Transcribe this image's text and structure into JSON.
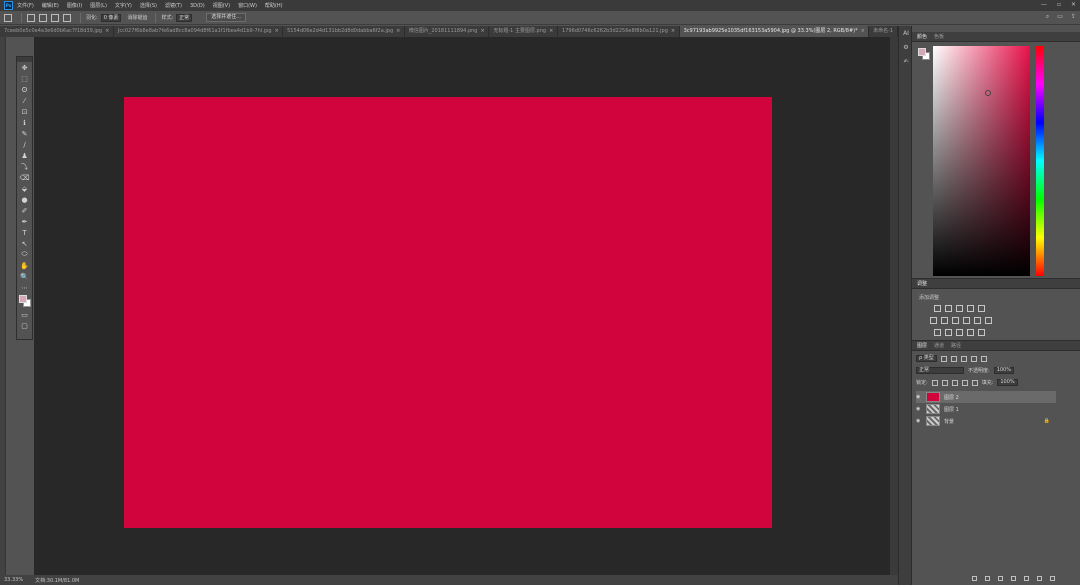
{
  "menubar": {
    "logo": "Ps",
    "items": [
      "文件(F)",
      "编辑(E)",
      "图像(I)",
      "图层(L)",
      "文字(Y)",
      "选择(S)",
      "滤镜(T)",
      "3D(D)",
      "视图(V)",
      "窗口(W)",
      "帮助(H)"
    ],
    "window_controls": [
      "—",
      "▫",
      "✕"
    ]
  },
  "options_bar": {
    "feather_label": "羽化:",
    "feather_value": "0 像素",
    "antialias_label": "消除锯齿",
    "style_label": "样式:",
    "style_value": "正常",
    "select_button": "选择并遮住..."
  },
  "tabs": [
    {
      "label": "7ceeb0e5c0e4a3e6d0b6ac7f18d39.jpg",
      "active": false
    },
    {
      "label": "Jcc027f6b8e8ab7fe6ad8cc8a094d8f61a1f1fbea4d1b9-7hl.jpg",
      "active": false
    },
    {
      "label": "5154d06e2d4d131bb2d8d0dabba6f2a.jpg",
      "active": false
    },
    {
      "label": "微信图片_20181111894.png",
      "active": false
    },
    {
      "label": "无标题-1 主要图层.png",
      "active": false
    },
    {
      "label": "1796d0746c6262b3d2256e8f8b0a121.jpg",
      "active": false
    },
    {
      "label": "3c97193ab9925e1035df163153a5904.jpg @ 33.3%(图层 2, RGB/8#)*",
      "active": true
    },
    {
      "label": "未命名-1",
      "active": false
    }
  ],
  "tools": [
    "✥",
    "⬚",
    "ʘ",
    "⁄",
    "⊡",
    "ℹ",
    "✎",
    "∕",
    "♟",
    "⤵",
    "⌫",
    "⬙",
    "●",
    "✐",
    "✒",
    "T",
    "↖",
    "⬭",
    "✋",
    "🔍",
    "⋯"
  ],
  "status": {
    "zoom": "33.33%",
    "doc_info": "文档:30.1M/81.0M"
  },
  "right_strip_icons": [
    "AI",
    "⚙",
    "✍"
  ],
  "color_panel": {
    "tabs": [
      "颜色",
      "色板"
    ],
    "foreground": "#d5a7b7",
    "background": "#ffffff",
    "hue_color": "#e8124a"
  },
  "adjustments_panel": {
    "tab": "调整",
    "subtitle": "添加调整"
  },
  "layers_panel": {
    "tabs": [
      "图层",
      "通道",
      "路径"
    ],
    "filter_label": "ρ 类型",
    "blend_mode": "正常",
    "opacity_label": "不透明度:",
    "opacity_value": "100%",
    "lock_label": "锁定:",
    "fill_label": "填充:",
    "fill_value": "100%",
    "layers": [
      {
        "name": "图层 2",
        "thumb": "red",
        "selected": true,
        "locked": false
      },
      {
        "name": "图层 1",
        "thumb": "pattern",
        "selected": false,
        "locked": false
      },
      {
        "name": "背景",
        "thumb": "pattern",
        "selected": false,
        "locked": true
      }
    ]
  },
  "canvas": {
    "fill": "#d2043e"
  }
}
